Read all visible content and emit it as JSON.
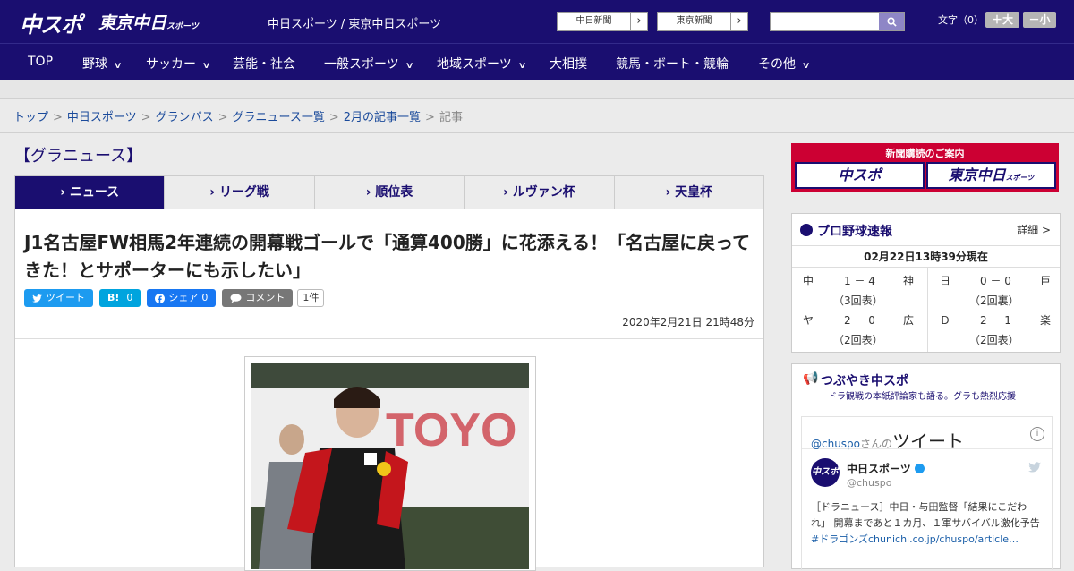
{
  "header": {
    "logo_main": "中スポ",
    "logo_tokyo": "東京中日",
    "logo_tokyo_small": "スポーツ",
    "site_name": "中日スポーツ / 東京中日スポーツ",
    "paper_buttons": [
      {
        "label": "中日新聞"
      },
      {
        "label": "東京新聞"
      }
    ],
    "search": {
      "placeholder": "",
      "value": ""
    },
    "font_size_label": "文字（0）",
    "font_larger": "＋大",
    "font_smaller": "－小"
  },
  "nav": {
    "items": [
      {
        "label": "TOP"
      },
      {
        "label": "野球"
      },
      {
        "label": "サッカー"
      },
      {
        "label": "芸能・社会"
      },
      {
        "label": "一般スポーツ"
      },
      {
        "label": "地域スポーツ"
      },
      {
        "label": "大相撲"
      },
      {
        "label": "競馬・ボート・競輪"
      },
      {
        "label": "その他"
      }
    ]
  },
  "breadcrumb": {
    "items": [
      "トップ",
      "中日スポーツ",
      "グランパス",
      "グラニュース一覧",
      "2月の記事一覧"
    ],
    "current": "記事",
    "sep": ">"
  },
  "section": {
    "title": "【グラニュース】",
    "tabs": [
      {
        "label": "ニュース",
        "active": true
      },
      {
        "label": "リーグ戦"
      },
      {
        "label": "順位表"
      },
      {
        "label": "ルヴァン杯"
      },
      {
        "label": "天皇杯"
      }
    ]
  },
  "article": {
    "headline": "J1名古屋FW相馬2年連続の開幕戦ゴールで「通算400勝」に花添える！「名古屋に戻ってきた！とサポーターにも示したい」",
    "date": "2020年2月21日 21時48分",
    "social": {
      "tweet": "ツイート",
      "hatena": "B!",
      "hatena_count": "0",
      "share": "シェア",
      "share_count": "0",
      "comment": "コメント",
      "comment_count": "1件"
    }
  },
  "sidebar": {
    "subscribe": {
      "title": "新聞購読のご案内",
      "buttons": [
        "中スポ",
        "東京中日"
      ],
      "tokyo_small": "スポーツ"
    },
    "baseball": {
      "title": "プロ野球速報",
      "detail": "詳細 >",
      "timestamp": "02月22日13時39分現在",
      "games": [
        {
          "home": "中",
          "score": "1 － 4",
          "away": "神",
          "inning": "（3回表）"
        },
        {
          "home": "日",
          "score": "0 － 0",
          "away": "巨",
          "inning": "（2回裏）"
        },
        {
          "home": "ヤ",
          "score": "2 － 0",
          "away": "広",
          "inning": "（2回表）"
        },
        {
          "home": "Ｄ",
          "score": "2 － 1",
          "away": "楽",
          "inning": "（2回表）"
        }
      ]
    },
    "twitter": {
      "title": "つぶやき中スポ",
      "subtitle": "ドラ観戦の本紙評論家も語る。グラも熱烈応援",
      "handle_link": "@chuspo",
      "handle_suffix": "さんの",
      "tweets_word": "ツイート",
      "account_name": "中日スポーツ",
      "account_handle": "@chuspo",
      "avatar_text": "中スポ",
      "tweet_text": "［ドラニュース］中日・与田監督「結果にこだわれ」 開幕まであと１カ月、１軍サバイバル激化予告",
      "tweet_link": "#ドラゴンズchunichi.co.jp/chuspo/article…"
    }
  },
  "colors": {
    "brand_navy": "#1a0e70",
    "accent_red": "#cc0033",
    "twitter_blue": "#1d9bf0",
    "hatena_blue": "#00a4de",
    "facebook_blue": "#1877f2"
  },
  "icons": [
    "search-icon",
    "chevron-right-icon",
    "chevron-down-icon",
    "twitter-icon",
    "facebook-icon",
    "comment-icon",
    "baseball-icon",
    "megaphone-icon",
    "info-icon",
    "verified-icon"
  ]
}
